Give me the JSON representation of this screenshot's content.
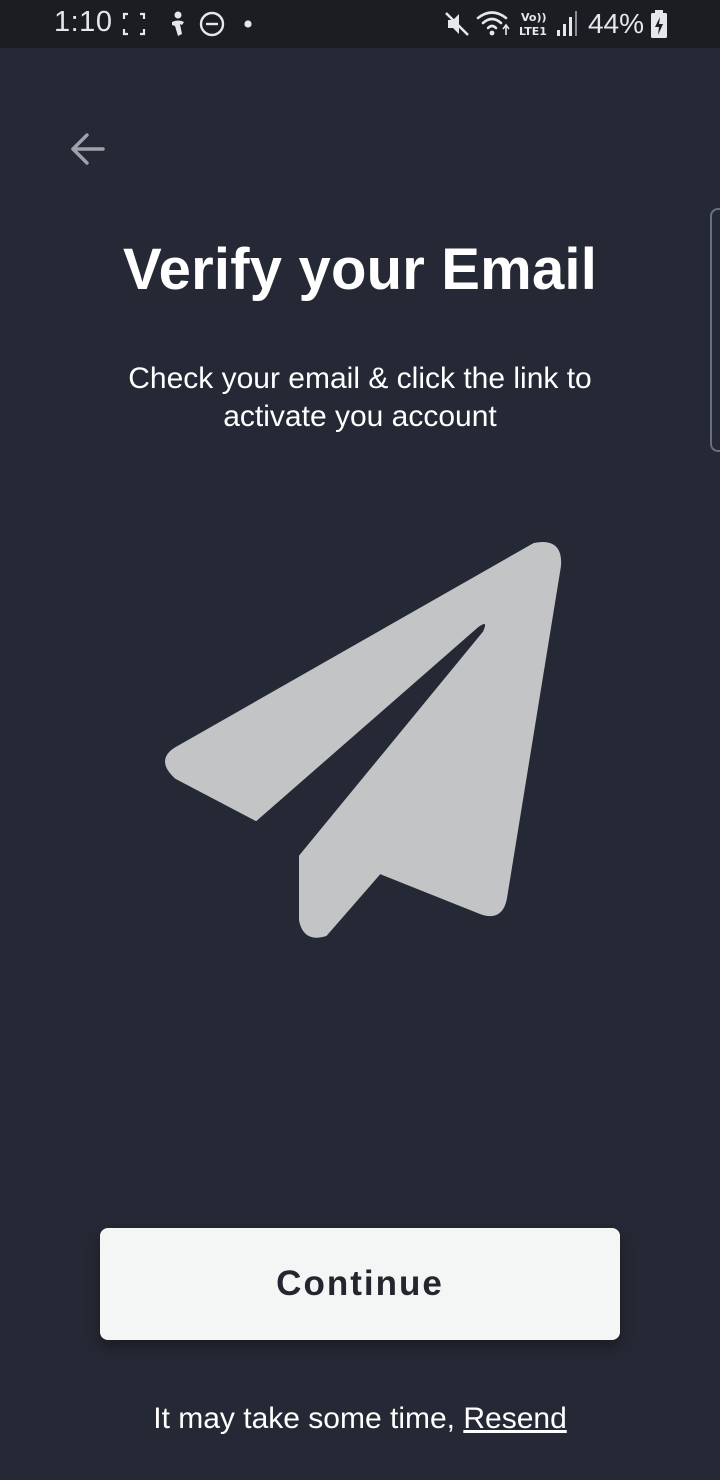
{
  "status_bar": {
    "time": "1:10",
    "battery_percent": "44%",
    "left_icons": [
      "screenshot-frame-icon",
      "accessibility-icon",
      "do-not-disturb-icon",
      "notification-dot-icon"
    ],
    "right_icons": [
      "mute-icon",
      "wifi-icon",
      "volte-lte-icon",
      "signal-icon",
      "battery-charging-icon"
    ],
    "network_label_top": "Vo))",
    "network_label_bottom": "LTE1"
  },
  "header": {
    "back_icon": "arrow-left-icon"
  },
  "main": {
    "title": "Verify your Email",
    "subtitle": "Check your email & click the link to activate you account",
    "illustration_icon": "paper-plane-icon"
  },
  "actions": {
    "continue_label": "Continue"
  },
  "footer": {
    "prefix": "It may take some time, ",
    "resend_label": "Resend"
  },
  "colors": {
    "background": "#252935",
    "status_bar": "#1b1d23",
    "illustration": "#c2c4c6",
    "button_bg": "#f4f6f5",
    "button_text": "#23262e",
    "text": "#ffffff"
  }
}
